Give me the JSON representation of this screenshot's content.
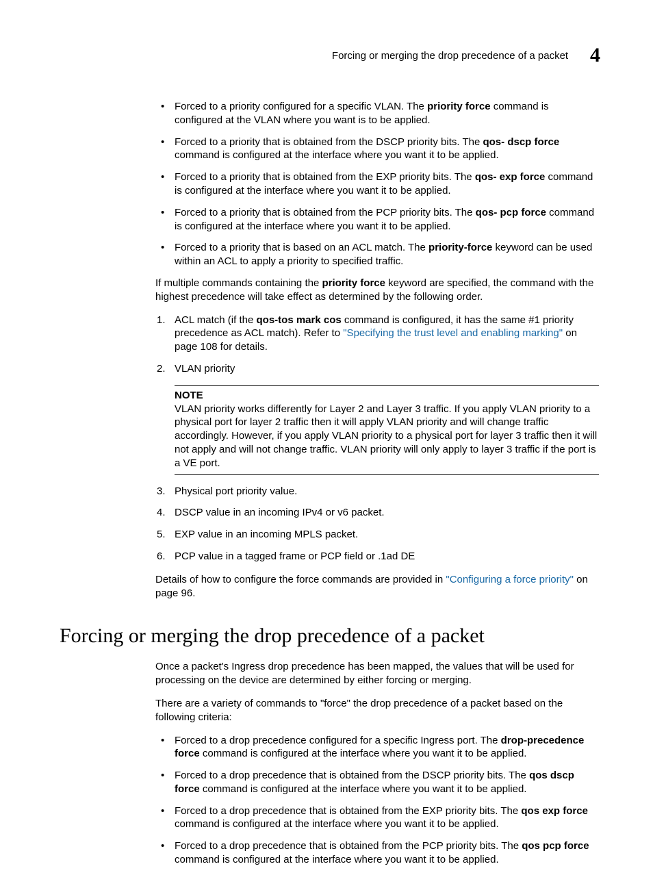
{
  "header": {
    "title": "Forcing or merging the drop precedence of a packet",
    "chapter_number": "4"
  },
  "bullets_top": [
    {
      "pre": "Forced to a priority configured for a specific VLAN. The ",
      "cmd": "priority force",
      "post": " command is configured at the VLAN where you want is to be applied."
    },
    {
      "pre": "Forced to a priority that is obtained from the DSCP priority bits. The ",
      "cmd": "qos- dscp force",
      "post": " command is configured at the interface where you want it to be applied."
    },
    {
      "pre": "Forced to a priority that is obtained from the EXP priority bits. The ",
      "cmd": "qos- exp force",
      "post": " command is configured at the interface where you want it to be applied."
    },
    {
      "pre": "Forced to a priority that is obtained from the PCP priority bits. The ",
      "cmd": "qos- pcp force",
      "post": " command is configured at the interface where you want it to be applied."
    },
    {
      "pre": "Forced to a priority that is based on an ACL match. The ",
      "cmd": "priority-force",
      "post": " keyword can be used within an ACL to apply a priority to specified traffic."
    }
  ],
  "para_multiple": {
    "pre": "If multiple commands containing the ",
    "cmd": "priority force",
    "post": " keyword are specified, the command with the highest precedence will take effect as determined by the following order."
  },
  "ol_first": [
    {
      "pre": "ACL match (if the ",
      "cmd": "qos-tos mark cos",
      "mid": " command is configured, it has the same #1 priority precedence as ACL match). Refer to ",
      "link": "\"Specifying the trust level and enabling marking\"",
      "post": " on page 108 for details."
    },
    {
      "text": "VLAN priority"
    }
  ],
  "note": {
    "label": "NOTE",
    "text": "VLAN priority works differently for Layer 2 and Layer 3 traffic. If you apply VLAN priority to a physical port for layer 2 traffic then it will apply VLAN priority and will change traffic accordingly. However, if you apply VLAN priority to a physical port for layer 3 traffic then it will not apply and will not change traffic. VLAN priority will only apply to layer 3 traffic if the port is a VE port."
  },
  "ol_second": [
    "Physical port priority value.",
    "DSCP value in an incoming IPv4 or v6 packet.",
    "EXP value in an incoming MPLS packet.",
    "PCP value in a tagged frame or PCP field or .1ad DE"
  ],
  "para_details": {
    "pre": "Details of how to configure the force commands are provided in ",
    "link": "\"Configuring a force priority\"",
    "post": " on page 96."
  },
  "section_heading": "Forcing or merging the drop precedence of a packet",
  "para_once": "Once a packet's Ingress drop precedence has been mapped, the values that will be used for processing on the device are determined by either forcing or merging.",
  "para_variety": "There are a variety of commands to \"force\" the drop precedence of a packet based on the following criteria:",
  "bullets_bottom": [
    {
      "pre": "Forced to a drop precedence configured for a specific Ingress port. The ",
      "cmd": "drop-precedence force",
      "post": " command is configured at the interface where you want it to be applied."
    },
    {
      "pre": "Forced to a drop precedence that is obtained from the DSCP priority bits. The ",
      "cmd": "qos dscp force",
      "post": " command is configured at the interface where you want it to be applied."
    },
    {
      "pre": "Forced to a drop precedence that is obtained from the EXP priority bits. The ",
      "cmd": "qos exp force",
      "post": " command is configured at the interface where you want it to be applied."
    },
    {
      "pre": "Forced to a drop precedence that is obtained from the PCP priority bits. The ",
      "cmd": "qos pcp force",
      "post": " command is configured at the interface where you want it to be applied."
    }
  ]
}
